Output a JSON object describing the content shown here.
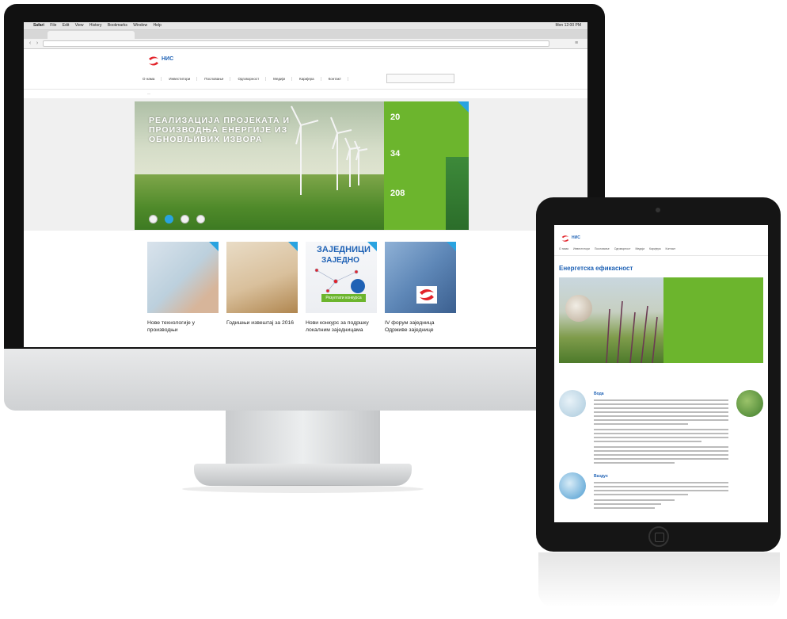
{
  "browser": {
    "menu": [
      "Safari",
      "File",
      "Edit",
      "View",
      "History",
      "Bookmarks",
      "Window",
      "Help"
    ],
    "clock": "Mon 12:00 PM",
    "tab_title": "",
    "url": ""
  },
  "site": {
    "logo_text": "НИС",
    "logo_sub": "",
    "header_links": [
      "",
      ""
    ],
    "nav": [
      "О нама",
      "Инвеститори",
      "Пословање",
      "Одговорност",
      "Медији",
      "Каријера",
      "Контакт"
    ],
    "hero_text": "Реализација пројеката и производња енергије из обновљивих извора",
    "stats": [
      {
        "num": "20",
        "text": ""
      },
      {
        "num": "34",
        "text": ""
      },
      {
        "num": "208",
        "text": ""
      }
    ],
    "cards": [
      {
        "caption": "Нове технологије у производњи"
      },
      {
        "caption": "Годишњи извештај за 2016"
      },
      {
        "caption": "Нови конкурс за подршку локалним заједницама",
        "title1": "ЗАЈЕДНИЦИ",
        "title2": "ЗАЈЕДНО",
        "badge": "Резултати конкурса"
      },
      {
        "caption": "IV форум заједница Одрживе заједнице"
      }
    ]
  },
  "tablet": {
    "logo_text": "НИС",
    "nav": [
      "О нама",
      "Инвеститори",
      "Пословање",
      "Одговорност",
      "Медији",
      "Каријера",
      "Контакт"
    ],
    "crumb": "",
    "title": "Енергетска ефикасност",
    "hero_panel": "",
    "lead": "",
    "sections": [
      {
        "heading": "Вода"
      },
      {
        "heading": "Ваздух"
      }
    ]
  },
  "colors": {
    "accent_green": "#6cb52d",
    "brand_blue": "#1f62b5",
    "accent_cyan": "#29a3e0"
  }
}
